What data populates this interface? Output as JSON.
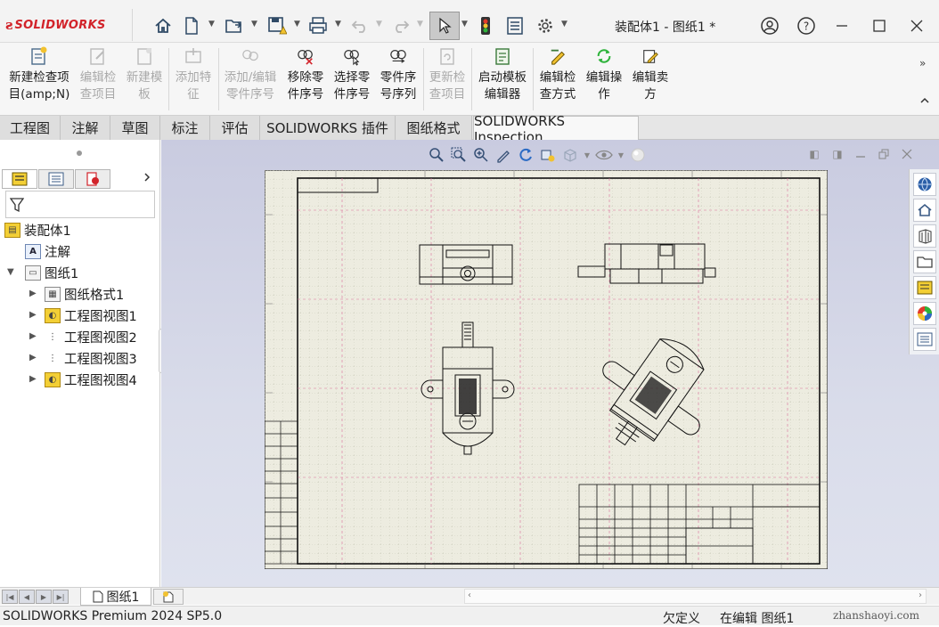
{
  "app": {
    "brand": "SOLIDWORKS",
    "document_title": "装配体1 - 图纸1 *"
  },
  "ribbon": {
    "buttons": [
      {
        "line1": "新建检查项",
        "line2": "目(amp;N)",
        "enabled": true,
        "icon": "new-inspection-icon"
      },
      {
        "line1": "编辑检",
        "line2": "查项目",
        "enabled": false,
        "icon": "edit-inspection-icon"
      },
      {
        "line1": "新建模",
        "line2": "板",
        "enabled": false,
        "icon": "new-template-icon"
      },
      {
        "line1": "添加特",
        "line2": "征",
        "enabled": false,
        "icon": "add-feature-icon"
      },
      {
        "line1": "添加/编辑",
        "line2": "零件序号",
        "enabled": false,
        "icon": "add-balloon-icon"
      },
      {
        "line1": "移除零",
        "line2": "件序号",
        "enabled": true,
        "icon": "remove-balloon-icon"
      },
      {
        "line1": "选择零",
        "line2": "件序号",
        "enabled": true,
        "icon": "select-balloon-icon"
      },
      {
        "line1": "零件序",
        "line2": "号序列",
        "enabled": true,
        "icon": "balloon-sequence-icon"
      },
      {
        "line1": "更新检",
        "line2": "查项目",
        "enabled": false,
        "icon": "update-inspection-icon"
      },
      {
        "line1": "启动模板",
        "line2": "编辑器",
        "enabled": true,
        "icon": "template-editor-icon"
      },
      {
        "line1": "编辑检",
        "line2": "查方式",
        "enabled": true,
        "icon": "edit-method-icon"
      },
      {
        "line1": "编辑操",
        "line2": "作",
        "enabled": true,
        "icon": "edit-operation-icon"
      },
      {
        "line1": "编辑卖",
        "line2": "方",
        "enabled": true,
        "icon": "edit-vendor-icon"
      }
    ]
  },
  "tabs": [
    "工程图",
    "注解",
    "草图",
    "标注",
    "评估",
    "SOLIDWORKS 插件",
    "图纸格式",
    "SOLIDWORKS Inspection"
  ],
  "tree": {
    "root": "装配体1",
    "items": [
      "注解",
      "图纸1",
      "图纸格式1",
      "工程图视图1",
      "工程图视图2",
      "工程图视图3",
      "工程图视图4"
    ]
  },
  "sheet_tab": "图纸1",
  "status": {
    "product": "SOLIDWORKS Premium 2024 SP5.0",
    "definition": "欠定义",
    "editing": "在编辑 图纸1"
  },
  "watermark": "zhanshaoyi.com"
}
